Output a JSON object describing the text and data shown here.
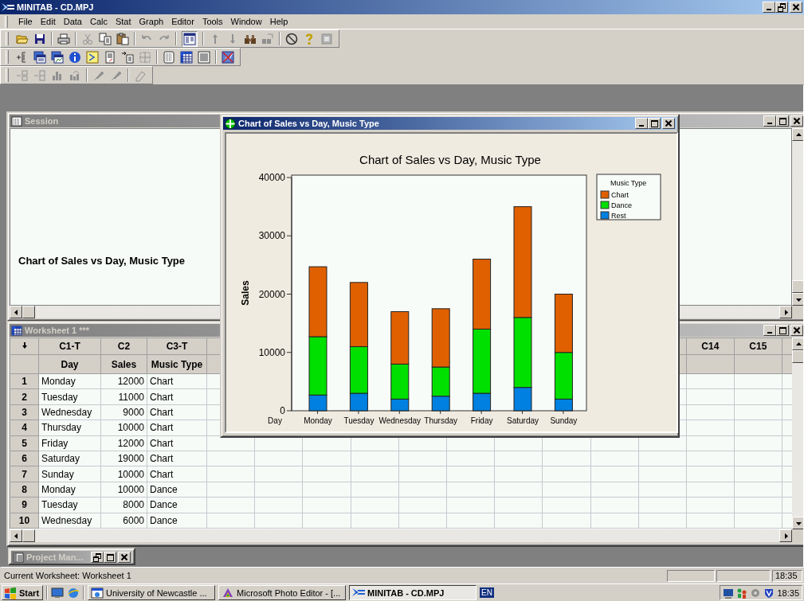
{
  "window": {
    "title": "MINITAB - CD.MPJ"
  },
  "menu": [
    "File",
    "Edit",
    "Data",
    "Calc",
    "Stat",
    "Graph",
    "Editor",
    "Tools",
    "Window",
    "Help"
  ],
  "session": {
    "title": "Session",
    "active": false,
    "output": "Chart of Sales vs Day, Music Type"
  },
  "worksheet": {
    "title": "Worksheet 1 ***",
    "active": false,
    "columns": [
      {
        "id": "C1-T",
        "name": "Day",
        "kind": "text"
      },
      {
        "id": "C2",
        "name": "Sales",
        "kind": "numeric"
      },
      {
        "id": "C3-T",
        "name": "Music Type",
        "kind": "text"
      },
      {
        "id": "C14"
      },
      {
        "id": "C15"
      }
    ],
    "rows": [
      {
        "number": "1",
        "cells": [
          "Monday",
          "12000",
          "Chart"
        ]
      },
      {
        "number": "2",
        "cells": [
          "Tuesday",
          "11000",
          "Chart"
        ]
      },
      {
        "number": "3",
        "cells": [
          "Wednesday",
          "9000",
          "Chart"
        ]
      },
      {
        "number": "4",
        "cells": [
          "Thursday",
          "10000",
          "Chart"
        ]
      },
      {
        "number": "5",
        "cells": [
          "Friday",
          "12000",
          "Chart"
        ]
      },
      {
        "number": "6",
        "cells": [
          "Saturday",
          "19000",
          "Chart"
        ]
      },
      {
        "number": "7",
        "cells": [
          "Sunday",
          "10000",
          "Chart"
        ]
      },
      {
        "number": "8",
        "cells": [
          "Monday",
          "10000",
          "Dance"
        ]
      },
      {
        "number": "9",
        "cells": [
          "Tuesday",
          "8000",
          "Dance"
        ]
      },
      {
        "number": "10",
        "cells": [
          "Wednesday",
          "6000",
          "Dance"
        ]
      }
    ]
  },
  "graph_window": {
    "title": "Chart of Sales vs Day, Music Type",
    "active": true,
    "chart_data": {
      "type": "bar",
      "title": "Chart of Sales vs Day, Music Type",
      "xlabel": "Day",
      "ylabel": "Sales",
      "stacked": true,
      "categories": [
        "Monday",
        "Tuesday",
        "Wednesday",
        "Thursday",
        "Friday",
        "Saturday",
        "Sunday"
      ],
      "series": [
        {
          "name": "Chart",
          "color": "#e06000",
          "values": [
            12000,
            11000,
            9000,
            10000,
            12000,
            19000,
            10000
          ]
        },
        {
          "name": "Dance",
          "color": "#00e000",
          "values": [
            10000,
            8000,
            6000,
            5000,
            11000,
            12000,
            8000
          ]
        },
        {
          "name": "Rest",
          "color": "#0080e0",
          "values": [
            2700,
            3000,
            2000,
            2500,
            3000,
            4000,
            2000
          ]
        }
      ],
      "ylim": [
        0,
        40000
      ],
      "yticks": [
        0,
        10000,
        20000,
        30000,
        40000
      ],
      "legend": {
        "title": "Music Type"
      }
    }
  },
  "project_manager": {
    "title": "Project Man..."
  },
  "status_bar": {
    "message": "Current Worksheet: Worksheet 1",
    "time": "18:35"
  },
  "taskbar": {
    "start": "Start",
    "tasks": [
      {
        "label": "University of Newcastle ...",
        "selected": false,
        "kind": "browser"
      },
      {
        "label": "Microsoft Photo Editor - [...",
        "selected": false,
        "kind": "photo"
      },
      {
        "label": "MINITAB - CD.MPJ",
        "selected": true,
        "kind": "minitab"
      }
    ],
    "language": "EN",
    "clock": "18:35"
  }
}
